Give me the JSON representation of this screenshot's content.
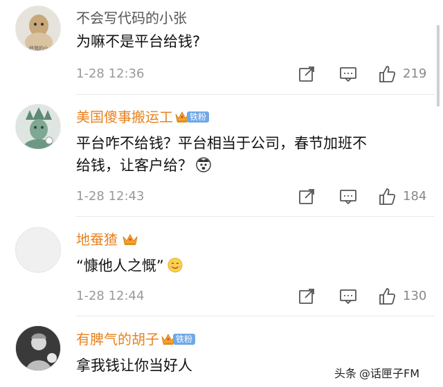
{
  "comments": [
    {
      "username": "不会写代码的小张",
      "text": "为嘛不是平台给钱?",
      "time": "1-28 12:36",
      "likes": "219",
      "vip": false,
      "avatar_caption": "终我的小"
    },
    {
      "username": "美国傻事搬运工",
      "text_line1": "平台咋不给钱？平台相当于公司，春节加班不",
      "text_line2": "给钱，让客户给？",
      "time": "1-28 12:43",
      "likes": "184",
      "vip": true,
      "badge": "铁粉"
    },
    {
      "username": "地蚕猹",
      "text": "“慷他人之慨”",
      "time": "1-28 12:44",
      "likes": "130",
      "vip": true
    },
    {
      "username": "有脾气的胡子",
      "text": "拿我钱让你当好人",
      "vip": true,
      "badge": "铁粉"
    }
  ],
  "icons": [
    "share-icon",
    "comment-icon",
    "like-icon",
    "crown-icon"
  ],
  "colors": {
    "vip_name": "#e8821f",
    "plain_name": "#555555",
    "meta": "#999999",
    "badge": "#6fa8e6"
  },
  "watermark": {
    "source": "头条",
    "account": "@话匣子FM"
  }
}
